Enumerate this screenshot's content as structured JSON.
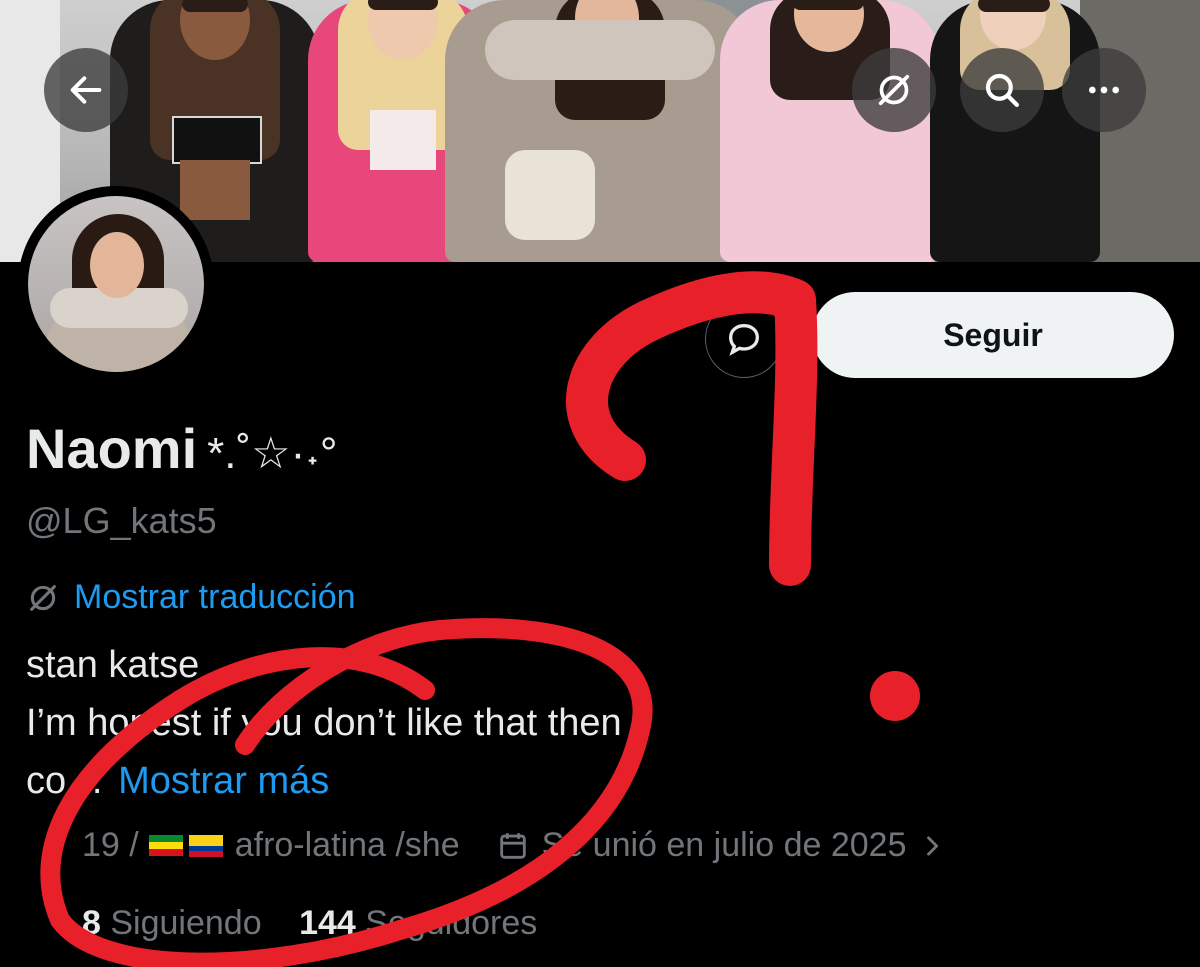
{
  "profile": {
    "name": "Naomi",
    "name_decoration": "*.˚☆·˖°",
    "handle": "@LG_kats5",
    "translate_link": "Mostrar traducción",
    "bio_line1": "stan katse",
    "bio_line2": "I’m honest if you don’t like that then",
    "bio_line3": "co…",
    "show_more": "Mostrar más",
    "location_text": "19 /",
    "identity_text": "afro-latina /she",
    "joined_text": "Se unió en julio de 2025",
    "following_count": "8",
    "following_label": "Siguiendo",
    "followers_count": "144",
    "followers_label": "Seguidores"
  },
  "actions": {
    "follow_label": "Seguir"
  },
  "icons": {
    "back": "arrow-left-icon",
    "grok": "grok-icon",
    "search": "search-icon",
    "more": "more-icon",
    "message": "message-icon",
    "translate": "translate-icon",
    "calendar": "calendar-icon",
    "chevron": "chevron-right-icon"
  },
  "colors": {
    "background": "#000000",
    "text": "#e7e9ea",
    "secondary": "#71767b",
    "link": "#1d9bf0",
    "follow_bg": "#eff3f4",
    "annotation": "#e8202a"
  }
}
